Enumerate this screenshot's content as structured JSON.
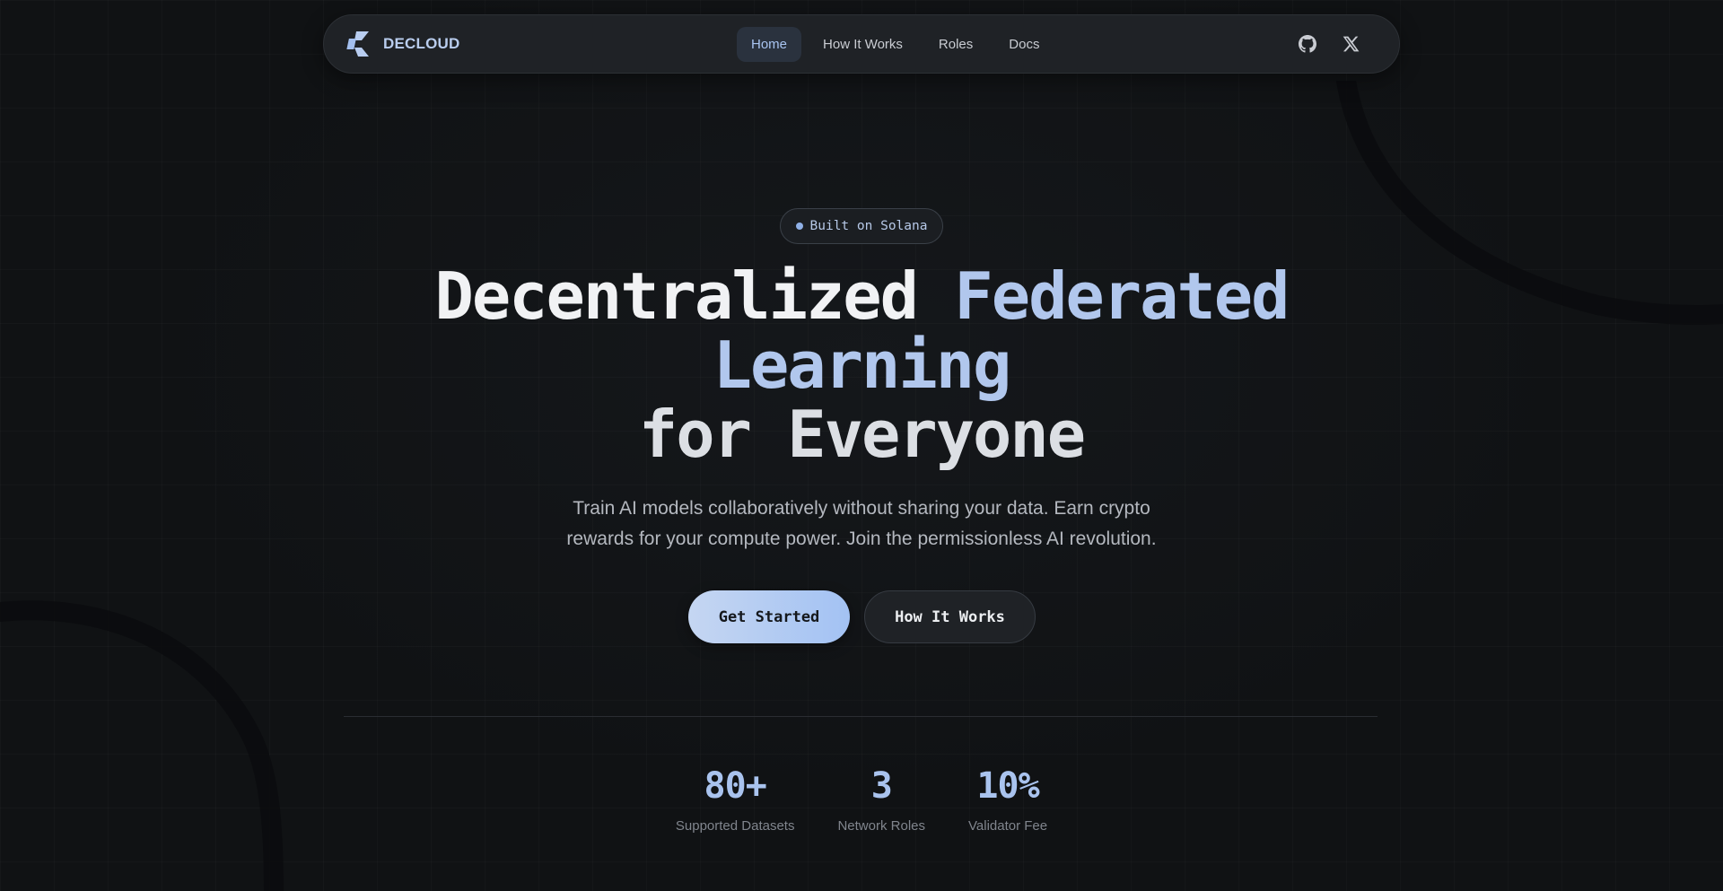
{
  "nav": {
    "brand": "DECLOUD",
    "links": [
      {
        "label": "Home",
        "active": true
      },
      {
        "label": "How It Works",
        "active": false
      },
      {
        "label": "Roles",
        "active": false
      },
      {
        "label": "Docs",
        "active": false
      }
    ],
    "icons": [
      "github-icon",
      "x-icon"
    ]
  },
  "hero": {
    "badge": "Built on Solana",
    "headline": {
      "line1_white": "Decentralized",
      "line1_blue": "Federated",
      "line2_blue": "Learning",
      "line3": "for Everyone"
    },
    "subtitle_line1": "Train AI models collaboratively without sharing your data. Earn crypto",
    "subtitle_line2": "rewards for your compute power. Join the permissionless AI revolution.",
    "primary_cta": "Get Started",
    "secondary_cta": "How It Works"
  },
  "stats": [
    {
      "value": "80+",
      "label": "Supported Datasets"
    },
    {
      "value": "3",
      "label": "Network Roles"
    },
    {
      "value": "10%",
      "label": "Validator Fee"
    }
  ],
  "colors": {
    "background": "#101214",
    "accent": "#a9c3ee",
    "nav_bg": "#1f2226"
  }
}
